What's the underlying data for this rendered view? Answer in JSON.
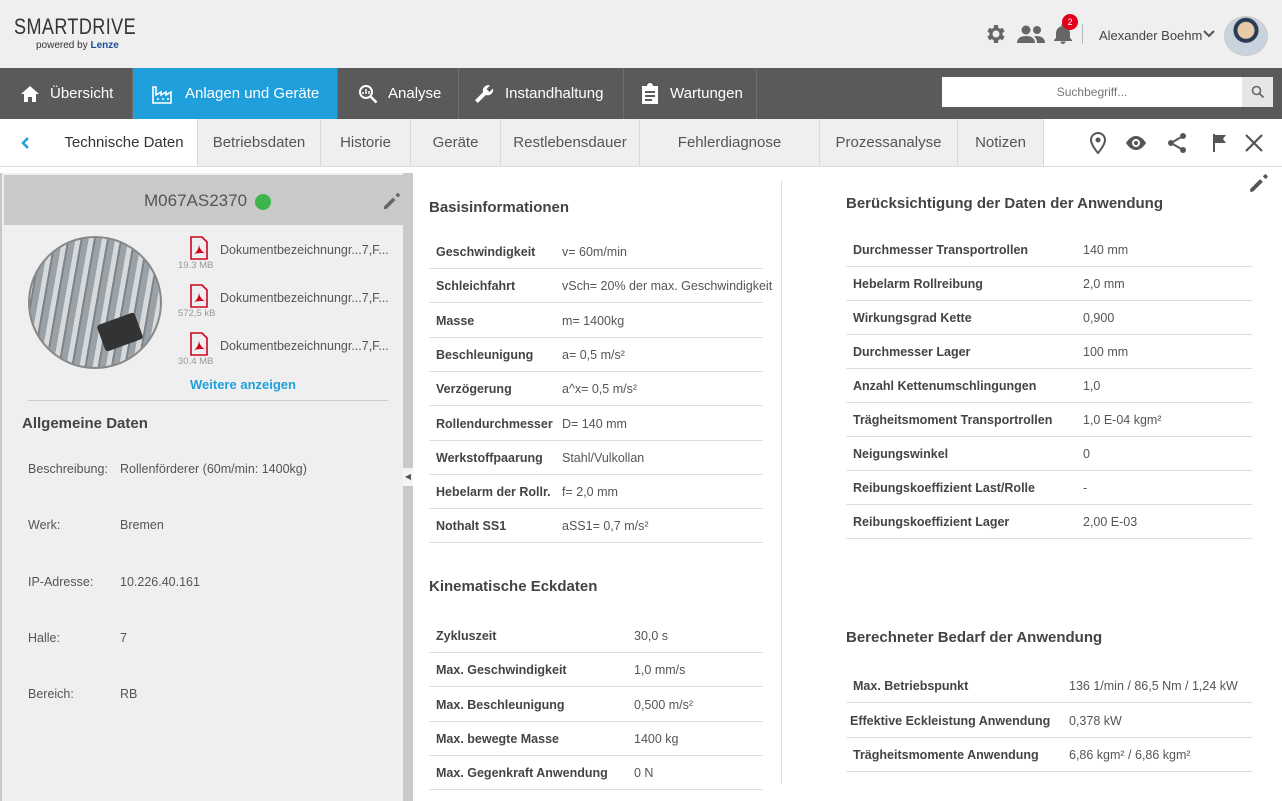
{
  "header": {
    "brand_title": "SMARTDRIVE",
    "brand_powered": "powered by",
    "brand_vendor": "Lenze",
    "notification_count": "2",
    "user_name": "Alexander Boehm"
  },
  "nav": {
    "items": [
      {
        "label": "Übersicht",
        "icon": "home-icon"
      },
      {
        "label": "Anlagen und Geräte",
        "icon": "factory-icon",
        "active": true
      },
      {
        "label": "Analyse",
        "icon": "analysis-search-icon"
      },
      {
        "label": "Instandhaltung",
        "icon": "wrench-icon"
      },
      {
        "label": "Wartungen",
        "icon": "clipboard-icon"
      }
    ],
    "search_placeholder": "Suchbegriff..."
  },
  "tabs": [
    "Technische Daten",
    "Betriebsdaten",
    "Historie",
    "Geräte",
    "Restlebensdauer",
    "Fehlerdiagnose",
    "Prozessanalyse",
    "Notizen"
  ],
  "left_panel": {
    "title": "M067AS2370",
    "status_color": "#3cb54a",
    "documents": [
      {
        "name": "Dokumentbezeichnungr...7,F...",
        "size": "19.3 MB"
      },
      {
        "name": "Dokumentbezeichnungr...7,F...",
        "size": "572,5 kB"
      },
      {
        "name": "Dokumentbezeichnungr...7,F...",
        "size": "30.4 MB"
      }
    ],
    "more_link": "Weitere anzeigen",
    "general_title": "Allgemeine Daten",
    "general": [
      {
        "label": "Beschreibung:",
        "value": "Rollenförderer (60m/min: 1400kg)"
      },
      {
        "label": "Werk:",
        "value": "Bremen"
      },
      {
        "label": "IP-Adresse:",
        "value": "10.226.40.161"
      },
      {
        "label": "Halle:",
        "value": "7"
      },
      {
        "label": "Bereich:",
        "value": "RB"
      }
    ]
  },
  "basis": {
    "title": "Basisinformationen",
    "rows": [
      {
        "label": "Geschwindigkeit",
        "value": "v= 60m/min"
      },
      {
        "label": "Schleichfahrt",
        "value": "vSch= 20% der max. Geschwindigkeit"
      },
      {
        "label": "Masse",
        "value": "m= 1400kg"
      },
      {
        "label": "Beschleunigung",
        "value": "a= 0,5 m/s²"
      },
      {
        "label": "Verzögerung",
        "value": "a^x= 0,5 m/s²"
      },
      {
        "label": "Rollendurchmesser",
        "value": "D= 140 mm"
      },
      {
        "label": "Werkstoffpaarung",
        "value": "Stahl/Vulkollan"
      },
      {
        "label": "Hebelarm der Rollr.",
        "value": "f= 2,0 mm"
      },
      {
        "label": "Nothalt SS1",
        "value": "aSS1= 0,7 m/s²"
      }
    ]
  },
  "kinematik": {
    "title": "Kinematische Eckdaten",
    "rows": [
      {
        "label": "Zykluszeit",
        "value": "30,0 s"
      },
      {
        "label": "Max. Geschwindigkeit",
        "value": "1,0 mm/s"
      },
      {
        "label": "Max. Beschleunigung",
        "value": "0,500 m/s²"
      },
      {
        "label": "Max. bewegte Masse",
        "value": "1400 kg"
      },
      {
        "label": "Max. Gegenkraft Anwendung",
        "value": "0 N"
      }
    ]
  },
  "anwendung": {
    "title": "Berücksichtigung der Daten der Anwendung",
    "rows": [
      {
        "label": "Durchmesser Transportrollen",
        "value": "140 mm"
      },
      {
        "label": "Hebelarm Rollreibung",
        "value": "2,0 mm"
      },
      {
        "label": "Wirkungsgrad Kette",
        "value": "0,900"
      },
      {
        "label": "Durchmesser Lager",
        "value": "100 mm"
      },
      {
        "label": "Anzahl Kettenumschlingungen",
        "value": "1,0"
      },
      {
        "label": "Trägheitsmoment Transportrollen",
        "value": "1,0 E-04 kgm²"
      },
      {
        "label": "Neigungswinkel",
        "value": "0"
      },
      {
        "label": "Reibungskoeffizient Last/Rolle",
        "value": "-"
      },
      {
        "label": "Reibungskoeffizient Lager",
        "value": "2,00 E-03"
      }
    ]
  },
  "bedarf": {
    "title": "Berechneter Bedarf der Anwendung",
    "rows": [
      {
        "label": "Max. Betriebspunkt",
        "value": "136 1/min / 86,5 Nm / 1,24 kW"
      },
      {
        "label": "Effektive Eckleistung Anwendung",
        "value": "0,378 kW"
      },
      {
        "label": "Trägheitsmomente Anwendung",
        "value": "6,86 kgm² / 6,86 kgm²"
      }
    ]
  },
  "colors": {
    "accent": "#1fa0dc",
    "nav_bg": "#5a5a5a",
    "badge": "#e2001a",
    "pdf": "#d0021b"
  }
}
